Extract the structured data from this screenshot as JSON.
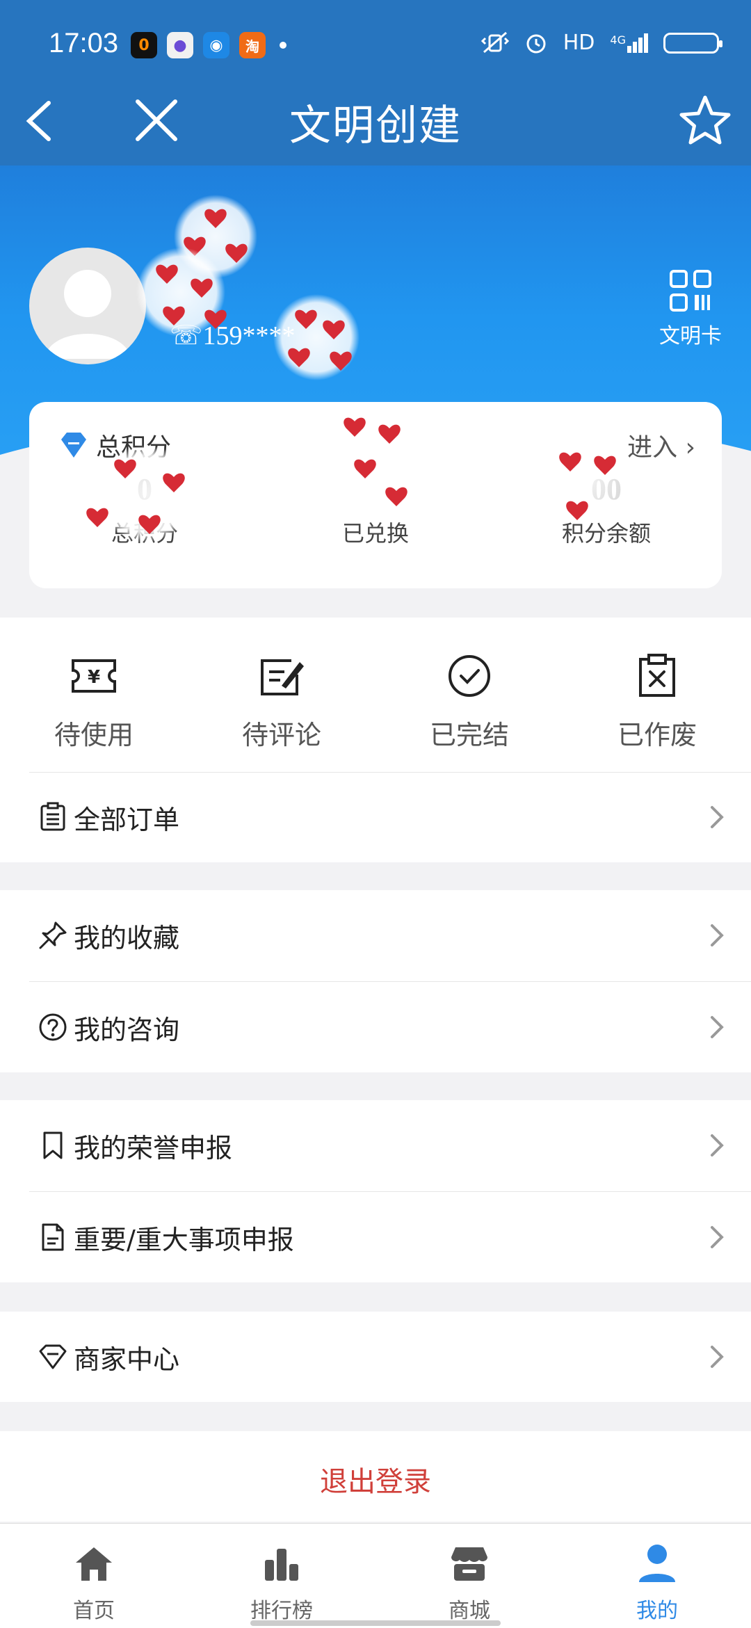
{
  "status_bar": {
    "time": "17:03",
    "network": "HD",
    "network_type": "4G",
    "apps": [
      {
        "icon": "pinduoduo-app-icon",
        "color": "#111111",
        "text": "0"
      },
      {
        "icon": "messages-app-icon",
        "color": "#f1f1f1",
        "text": "●"
      },
      {
        "icon": "camera-app-icon",
        "color": "#1e88e5",
        "text": "◉"
      },
      {
        "icon": "taobao-app-icon",
        "color": "#f06b16",
        "text": "淘"
      }
    ]
  },
  "nav": {
    "title": "文明创建"
  },
  "profile": {
    "phone": "159****",
    "card_label": "文明卡"
  },
  "points": {
    "title": "总积分",
    "enter_label": "进入",
    "stats": [
      {
        "value": "0",
        "label": "总积分"
      },
      {
        "value": "",
        "label": "已兑换"
      },
      {
        "value": "00",
        "label": "积分余额"
      }
    ]
  },
  "orders": {
    "items": [
      {
        "label": "待使用",
        "icon": "ticket-icon"
      },
      {
        "label": "待评论",
        "icon": "edit-icon"
      },
      {
        "label": "已完结",
        "icon": "check-circle-icon"
      },
      {
        "label": "已作废",
        "icon": "cancelled-clipboard-icon"
      }
    ],
    "all_orders": "全部订单"
  },
  "menu": {
    "favorites": "我的收藏",
    "consult": "我的咨询",
    "honor": "我的荣誉申报",
    "major": "重要/重大事项申报",
    "merchant": "商家中心"
  },
  "logout_label": "退出登录",
  "tabs": [
    {
      "label": "首页",
      "icon": "home-icon",
      "active": false
    },
    {
      "label": "排行榜",
      "icon": "ranking-icon",
      "active": false
    },
    {
      "label": "商城",
      "icon": "store-icon",
      "active": false
    },
    {
      "label": "我的",
      "icon": "user-icon",
      "active": true
    }
  ],
  "colors": {
    "primary": "#2775bf",
    "accent": "#2f8ae6",
    "logout": "#d0403a",
    "heart": "#d62b35"
  }
}
